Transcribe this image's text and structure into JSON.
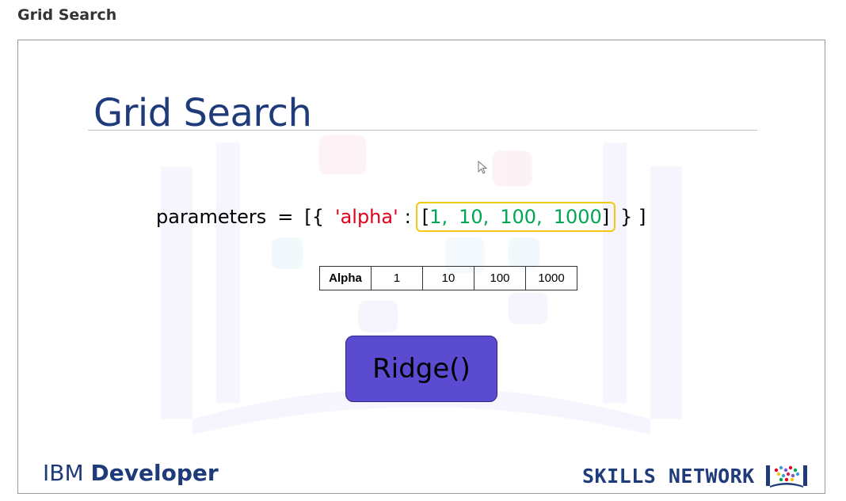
{
  "page": {
    "heading": "Grid Search"
  },
  "slide": {
    "title": "Grid Search",
    "code": {
      "var_name": "parameters",
      "assign": "=",
      "open_brackets": "[{",
      "key": "'alpha'",
      "colon": ":",
      "list_open": "[",
      "values": [
        "1,",
        "10,",
        "100,",
        "1000"
      ],
      "list_close": "]",
      "close_brackets": "} ]"
    },
    "table": {
      "header": "Alpha",
      "cells": [
        "1",
        "10",
        "100",
        "1000"
      ]
    },
    "model_button": "Ridge()",
    "brand_left": {
      "light": "IBM ",
      "bold": "Developer"
    },
    "brand_right": "SKILLS NETWORK"
  },
  "icons": [
    "cursor-icon",
    "skills-network-logo-icon"
  ],
  "colors": {
    "title": "#1f3b7a",
    "string": "#e3001b",
    "number": "#00a651",
    "highlight": "#f2c811",
    "button": "#5a4bd1"
  }
}
